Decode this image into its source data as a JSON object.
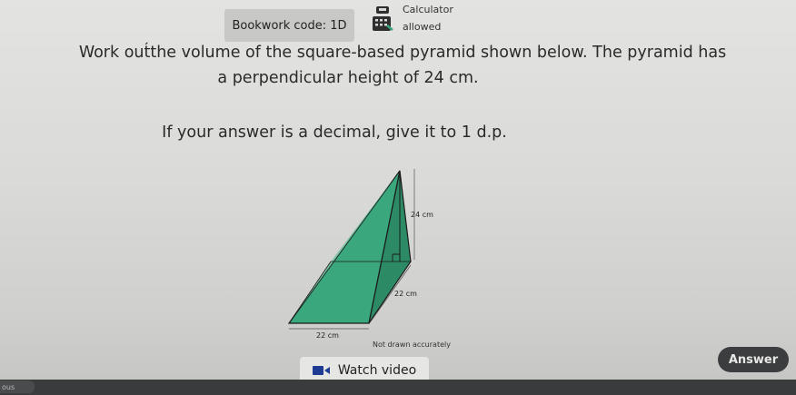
{
  "header": {
    "bookwork_code": "Bookwork code: 1D",
    "calculator_label": "Calculator",
    "calculator_status": "allowed"
  },
  "question": {
    "line1": "Work out́the volume of the square-based pyramid shown below. The pyramid has",
    "line2": "a perpendicular height of 24 cm.",
    "instruction": "If your answer is a decimal, give it to 1 d.p."
  },
  "diagram": {
    "height_label": "24 cm",
    "depth_label": "22 cm",
    "width_label": "22 cm",
    "note": "Not drawn accurately",
    "fill_color": "#3aa77d",
    "dark_fill_color": "#2c8a65",
    "line_color": "#1a1a1a"
  },
  "footer": {
    "watch_video_label": "Watch video",
    "answer_label": "Answer",
    "previous_label": "ous"
  }
}
